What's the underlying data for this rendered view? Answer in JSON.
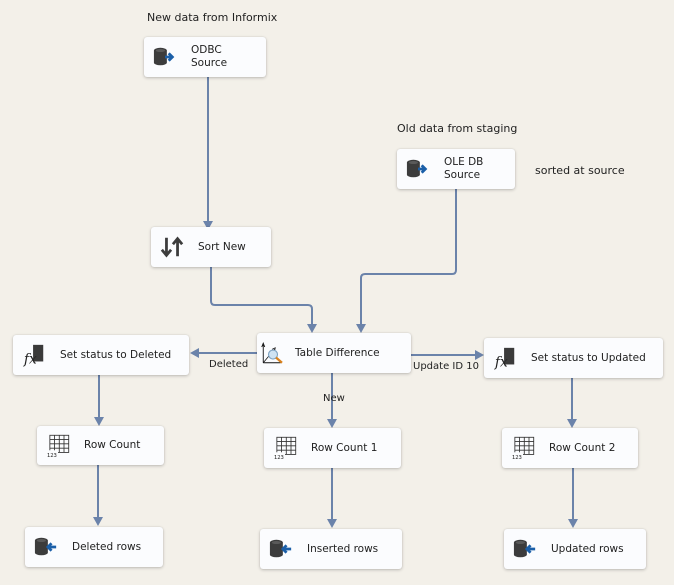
{
  "annotations": {
    "new_data": "New data from Informix",
    "old_data": "Old data from staging",
    "sorted": "sorted at source"
  },
  "nodes": {
    "odbc_source": {
      "label": "ODBC\nSource",
      "icon": "source-database-icon"
    },
    "oledb_source": {
      "label": "OLE DB\nSource",
      "icon": "source-database-icon"
    },
    "sort_new": {
      "label": "Sort New",
      "icon": "sort-icon"
    },
    "table_difference": {
      "label": "Table Difference",
      "icon": "table-difference-icon"
    },
    "set_deleted": {
      "label": "Set status to Deleted",
      "icon": "derived-column-icon"
    },
    "set_updated": {
      "label": "Set status to Updated",
      "icon": "derived-column-icon"
    },
    "row_count": {
      "label": "Row Count",
      "icon": "row-count-icon"
    },
    "row_count_1": {
      "label": "Row Count 1",
      "icon": "row-count-icon"
    },
    "row_count_2": {
      "label": "Row Count 2",
      "icon": "row-count-icon"
    },
    "deleted_rows": {
      "label": "Deleted rows",
      "icon": "destination-database-icon"
    },
    "inserted_rows": {
      "label": "Inserted rows",
      "icon": "destination-database-icon"
    },
    "updated_rows": {
      "label": "Updated rows",
      "icon": "destination-database-icon"
    }
  },
  "path_labels": {
    "deleted": "Deleted",
    "update": "Update ID 10",
    "new": "New"
  },
  "colors": {
    "canvas": "#f3f0e9",
    "connector": "#6b83aa",
    "node": "#fbfcfe"
  }
}
